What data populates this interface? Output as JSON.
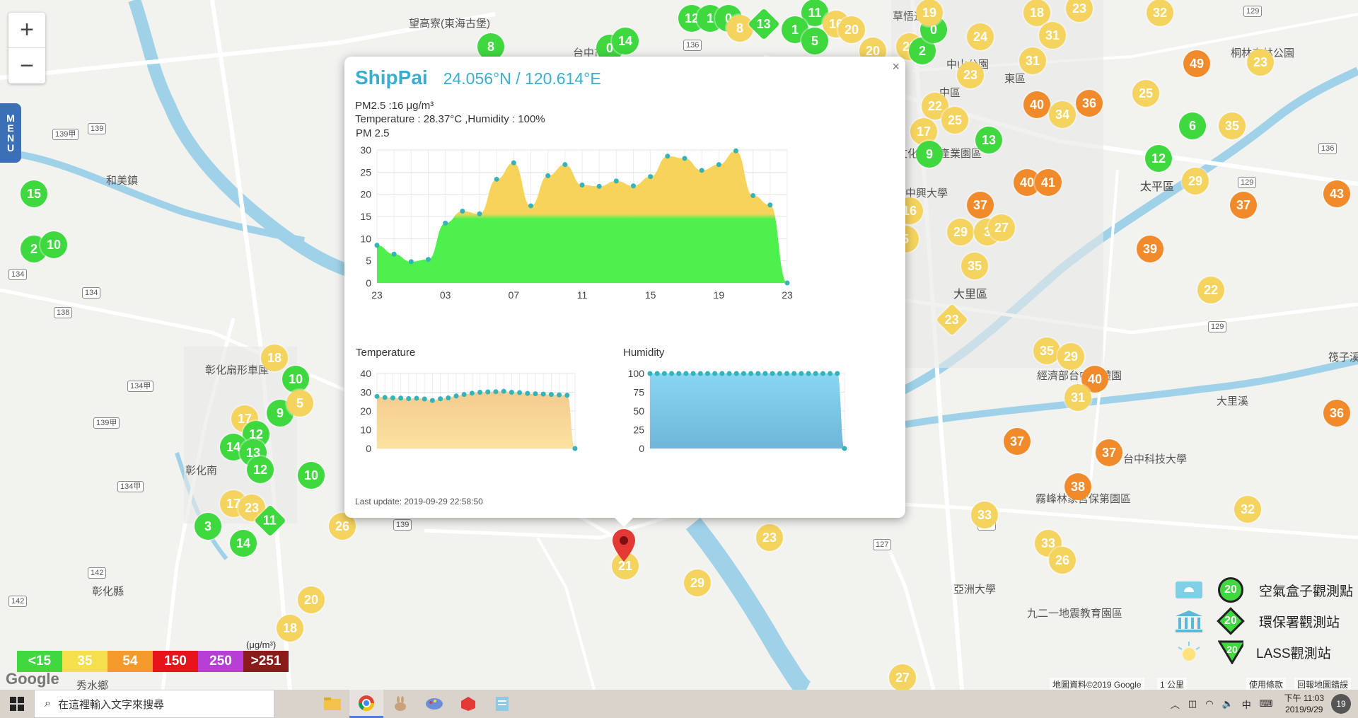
{
  "map": {
    "zoom_in": "+",
    "zoom_out": "−",
    "menu_letters": [
      "M",
      "E",
      "N",
      "U"
    ],
    "places": [
      {
        "id": "hemei",
        "text": "和美鎮"
      },
      {
        "id": "changhua",
        "text": "彰化縣"
      },
      {
        "id": "xiushui",
        "text": "秀水鄉"
      },
      {
        "id": "taiping",
        "text": "太平區"
      },
      {
        "id": "dali",
        "text": "大里區"
      },
      {
        "id": "dongqu",
        "text": "東區"
      },
      {
        "id": "zhongqu",
        "text": "中區"
      },
      {
        "id": "wufeng",
        "text": "霧峰林家宮保第園區"
      },
      {
        "id": "asia",
        "text": "亞洲大學"
      },
      {
        "id": "temple",
        "text": "望高寮(東海古堡)"
      },
      {
        "id": "edu",
        "text": "九二一地震教育園區"
      },
      {
        "id": "sanyi",
        "text": "經濟部台中軟體園"
      },
      {
        "id": "zhongxing",
        "text": "中興大學"
      },
      {
        "id": "park",
        "text": "中山公園"
      },
      {
        "id": "forest",
        "text": "桐林森林公園"
      },
      {
        "id": "lake",
        "text": "草悟道"
      },
      {
        "id": "art",
        "text": "文化創意產業園區"
      },
      {
        "id": "tech",
        "text": "台中科技大學"
      },
      {
        "id": "fan",
        "text": "彰化扇形車庫"
      },
      {
        "id": "sha",
        "text": "彰化南"
      },
      {
        "id": "river",
        "text": "筏子溪"
      },
      {
        "id": "river2",
        "text": "大里溪"
      },
      {
        "id": "dep",
        "text": "台中市南"
      }
    ],
    "markers": [
      {
        "v": "8",
        "lvl": 1
      },
      {
        "v": "0",
        "lvl": 1
      },
      {
        "v": "14",
        "lvl": 1
      },
      {
        "v": "12",
        "lvl": 1
      },
      {
        "v": "1",
        "lvl": 1
      },
      {
        "v": "0",
        "lvl": 1
      },
      {
        "v": "8",
        "lvl": 2
      },
      {
        "v": "13",
        "lvl": 1,
        "d": true
      },
      {
        "v": "11",
        "lvl": 1
      },
      {
        "v": "16",
        "lvl": 2
      },
      {
        "v": "1",
        "lvl": 1
      },
      {
        "v": "5",
        "lvl": 1
      },
      {
        "v": "20",
        "lvl": 2
      },
      {
        "v": "20",
        "lvl": 2
      },
      {
        "v": "25",
        "lvl": 2
      },
      {
        "v": "2",
        "lvl": 1
      },
      {
        "v": "0",
        "lvl": 1
      },
      {
        "v": "19",
        "lvl": 2
      },
      {
        "v": "24",
        "lvl": 2
      },
      {
        "v": "18",
        "lvl": 2
      },
      {
        "v": "31",
        "lvl": 2
      },
      {
        "v": "23",
        "lvl": 2
      },
      {
        "v": "32",
        "lvl": 2
      },
      {
        "v": "23",
        "lvl": 2
      },
      {
        "v": "31",
        "lvl": 2
      },
      {
        "v": "49",
        "lvl": 3
      },
      {
        "v": "23",
        "lvl": 2
      },
      {
        "v": "22",
        "lvl": 2
      },
      {
        "v": "25",
        "lvl": 2
      },
      {
        "v": "40",
        "lvl": 3
      },
      {
        "v": "34",
        "lvl": 2
      },
      {
        "v": "36",
        "lvl": 3
      },
      {
        "v": "25",
        "lvl": 2
      },
      {
        "v": "6",
        "lvl": 1
      },
      {
        "v": "35",
        "lvl": 2
      },
      {
        "v": "17",
        "lvl": 2
      },
      {
        "v": "13",
        "lvl": 1
      },
      {
        "v": "9",
        "lvl": 1
      },
      {
        "v": "12",
        "lvl": 1
      },
      {
        "v": "40",
        "lvl": 3
      },
      {
        "v": "41",
        "lvl": 3
      },
      {
        "v": "29",
        "lvl": 2
      },
      {
        "v": "43",
        "lvl": 3
      },
      {
        "v": "37",
        "lvl": 3
      },
      {
        "v": "37",
        "lvl": 3
      },
      {
        "v": "29",
        "lvl": 2
      },
      {
        "v": "3",
        "lvl": 2
      },
      {
        "v": "27",
        "lvl": 2
      },
      {
        "v": "39",
        "lvl": 3
      },
      {
        "v": "35",
        "lvl": 2
      },
      {
        "v": "22",
        "lvl": 2
      },
      {
        "v": "23",
        "lvl": 2,
        "d": true
      },
      {
        "v": "35",
        "lvl": 2
      },
      {
        "v": "29",
        "lvl": 2
      },
      {
        "v": "40",
        "lvl": 3
      },
      {
        "v": "31",
        "lvl": 2
      },
      {
        "v": "36",
        "lvl": 3
      },
      {
        "v": "37",
        "lvl": 3
      },
      {
        "v": "37",
        "lvl": 3
      },
      {
        "v": "38",
        "lvl": 3
      },
      {
        "v": "33",
        "lvl": 2
      },
      {
        "v": "32",
        "lvl": 2
      },
      {
        "v": "33",
        "lvl": 2
      },
      {
        "v": "26",
        "lvl": 2
      },
      {
        "v": "23",
        "lvl": 2
      },
      {
        "v": "29",
        "lvl": 2
      },
      {
        "v": "27",
        "lvl": 2
      },
      {
        "v": "15",
        "lvl": 1
      },
      {
        "v": "2",
        "lvl": 1
      },
      {
        "v": "10",
        "lvl": 1
      },
      {
        "v": "18",
        "lvl": 2
      },
      {
        "v": "10",
        "lvl": 1
      },
      {
        "v": "17",
        "lvl": 2
      },
      {
        "v": "9",
        "lvl": 1
      },
      {
        "v": "12",
        "lvl": 1
      },
      {
        "v": "14",
        "lvl": 1
      },
      {
        "v": "13",
        "lvl": 1
      },
      {
        "v": "12",
        "lvl": 1
      },
      {
        "v": "10",
        "lvl": 1
      },
      {
        "v": "17",
        "lvl": 2
      },
      {
        "v": "23",
        "lvl": 2
      },
      {
        "v": "11",
        "lvl": 1,
        "d": true
      },
      {
        "v": "3",
        "lvl": 1
      },
      {
        "v": "14",
        "lvl": 1
      },
      {
        "v": "26",
        "lvl": 2
      },
      {
        "v": "20",
        "lvl": 2
      },
      {
        "v": "18",
        "lvl": 2
      },
      {
        "v": "21",
        "lvl": 2
      },
      {
        "v": "16",
        "lvl": 2
      },
      {
        "v": "5",
        "lvl": 2
      },
      {
        "v": "5",
        "lvl": 2
      }
    ],
    "aqi_legend": [
      {
        "label": "<15",
        "color": "#3fd83f"
      },
      {
        "label": "35",
        "color": "#f4e04a"
      },
      {
        "label": "54",
        "color": "#f39a2a"
      },
      {
        "label": "150",
        "color": "#e8141c"
      },
      {
        "label": "250",
        "color": "#b63fd6"
      },
      {
        "label": ">251",
        "color": "#8b1a1a"
      }
    ],
    "aqi_unit": "(μg/m³)",
    "google": "Google",
    "attribution": {
      "data": "地圖資料©2019 Google",
      "scale": "1 公里",
      "terms": "使用條款",
      "report": "回報地圖錯誤"
    },
    "type_legend": [
      {
        "label": "空氣盒子觀測點",
        "value": "20",
        "icon": "airbox-icon"
      },
      {
        "label": "環保署觀測站",
        "value": "20",
        "icon": "government-building-icon"
      },
      {
        "label": "LASS觀測站",
        "value": "20",
        "icon": "lass-sun-icon"
      }
    ]
  },
  "popup": {
    "close": "×",
    "site_name": "ShipPai",
    "coord": "24.056°N / 120.614°E",
    "pm25_line": "PM2.5 :16 μg/m³",
    "temp_line": "Temperature : 28.37°C ,Humidity : 100%",
    "footer": "Last update: 2019-09-29 22:58:50"
  },
  "chart_data": [
    {
      "type": "area",
      "title": "PM 2.5",
      "x_ticks": [
        "23",
        "03",
        "07",
        "11",
        "15",
        "19",
        "23"
      ],
      "ylim": [
        0,
        30
      ],
      "y_ticks": [
        0,
        5,
        10,
        15,
        20,
        25,
        30
      ],
      "values": [
        8.5,
        6.5,
        4.8,
        5.3,
        13.5,
        16.2,
        15.6,
        23.4,
        27.1,
        17.4,
        24.2,
        26.7,
        22.1,
        21.8,
        23.0,
        21.9,
        24.0,
        28.6,
        28.1,
        25.4,
        26.7,
        29.8,
        19.7,
        17.6,
        0
      ],
      "grid": true,
      "fill": "green below 15, yellow above 15"
    },
    {
      "type": "area",
      "title": "Temperature",
      "ylim": [
        0,
        40
      ],
      "y_ticks": [
        0,
        10,
        20,
        30,
        40
      ],
      "values": [
        27.8,
        27.2,
        27.0,
        26.9,
        26.6,
        26.8,
        26.4,
        25.6,
        26.5,
        27.0,
        28.0,
        28.8,
        29.5,
        30.0,
        30.2,
        30.3,
        30.5,
        30.0,
        29.8,
        29.4,
        29.2,
        29.0,
        28.8,
        28.6,
        28.4,
        0
      ],
      "grid": true
    },
    {
      "type": "area",
      "title": "Humidity",
      "ylim": [
        0,
        100
      ],
      "y_ticks": [
        0,
        25,
        50,
        75,
        100
      ],
      "values": [
        100,
        100,
        100,
        100,
        100,
        100,
        100,
        100,
        100,
        100,
        100,
        100,
        100,
        100,
        100,
        100,
        100,
        100,
        100,
        100,
        100,
        100,
        100,
        100,
        100,
        100,
        100,
        0
      ],
      "grid": true
    }
  ],
  "taskbar": {
    "search_placeholder": "在這裡輸入文字來搜尋",
    "apps": [
      "file-explorer-icon",
      "chrome-icon",
      "app-rabbit-icon",
      "app-paint-icon",
      "app-sketchup-icon",
      "app-notepad-icon"
    ],
    "ime": "中",
    "time": "下午 11:03",
    "date": "2019/9/29",
    "notif_count": "19"
  }
}
